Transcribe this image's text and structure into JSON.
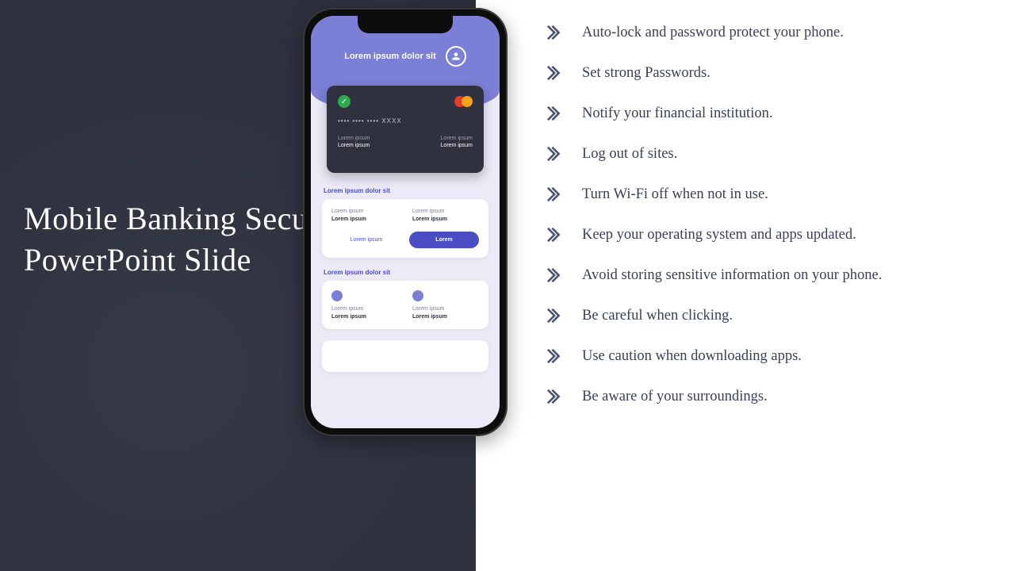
{
  "title": "Mobile Banking Security Tips PowerPoint Slide",
  "phone": {
    "header_text": "Lorem ipsum dolor sit",
    "card": {
      "number": "••••  ••••  ••••  XXXX",
      "label_left_top": "Lorem ipsum",
      "label_left_bottom": "Lorem ipsum",
      "label_right_top": "Lorem ipsum",
      "label_right_bottom": "Lorem ipsum"
    },
    "section_a": {
      "label": "Lorem ipsum dolor sit",
      "left_t1": "Lorem ipsum",
      "left_t2": "Lorem ipsum",
      "right_t1": "Lorem ipsum",
      "right_t2": "Lorem ipsum",
      "link": "Lorem ipsum",
      "button": "Lorem"
    },
    "section_b": {
      "label": "Lorem ipsum dolor sit",
      "left_t1": "Lorem ipsum",
      "left_t2": "Lorem ipsum",
      "right_t1": "Lorem ipsum",
      "right_t2": "Lorem ipsum"
    }
  },
  "tips": [
    "Auto-lock and password protect your phone.",
    "Set strong Passwords.",
    "Notify your financial institution.",
    "Log out of sites.",
    "Turn Wi-Fi off when not in use.",
    "Keep your operating system and apps updated.",
    "Avoid storing sensitive information on your phone.",
    "Be careful when clicking.",
    "Use caution when downloading apps.",
    "Be aware of your surroundings."
  ],
  "colors": {
    "accent": "#4a4dc4",
    "header": "#7b7fd6",
    "chevron": "#4a5272"
  }
}
